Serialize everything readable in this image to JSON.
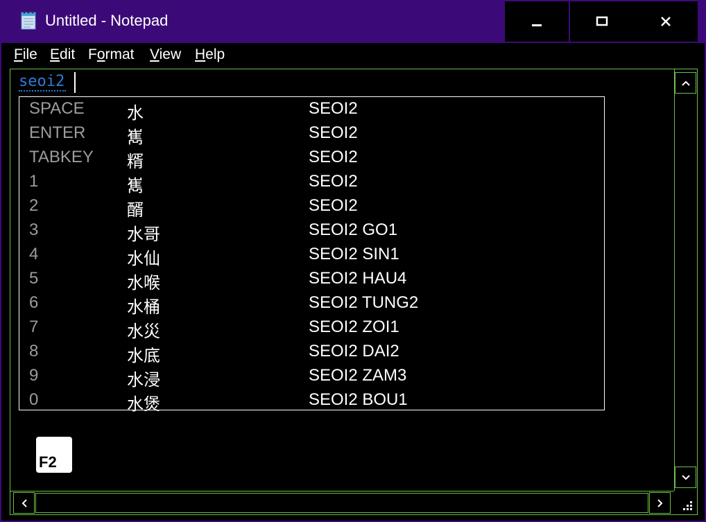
{
  "window": {
    "title": "Untitled - Notepad",
    "icons": {
      "app": "notepad-icon",
      "minimize": "minimize-icon",
      "maximize": "maximize-icon",
      "close": "close-icon"
    }
  },
  "menu": {
    "items": [
      {
        "label": "File",
        "mnemonic": "F",
        "rest": "ile"
      },
      {
        "label": "Edit",
        "mnemonic": "E",
        "rest": "dit"
      },
      {
        "label": "Format",
        "pre": "F",
        "mnemonic": "o",
        "rest": "rmat"
      },
      {
        "label": "View",
        "mnemonic": "V",
        "rest": "iew"
      },
      {
        "label": "Help",
        "mnemonic": "H",
        "rest": "elp"
      }
    ]
  },
  "editor": {
    "composition_text": "seoi2"
  },
  "candidates": [
    {
      "key": "SPACE",
      "char": "水",
      "code": "SEOI2"
    },
    {
      "key": "ENTER",
      "char": "嶲",
      "code": "SEOI2"
    },
    {
      "key": "TABKEY",
      "char": "糈",
      "code": "SEOI2"
    },
    {
      "key": "1",
      "char": "嶲",
      "code": "SEOI2"
    },
    {
      "key": "2",
      "char": "醑",
      "code": "SEOI2"
    },
    {
      "key": "3",
      "char": "水哥",
      "code": "SEOI2 GO1"
    },
    {
      "key": "4",
      "char": "水仙",
      "code": "SEOI2 SIN1"
    },
    {
      "key": "5",
      "char": "水喉",
      "code": "SEOI2 HAU4"
    },
    {
      "key": "6",
      "char": "水桶",
      "code": "SEOI2 TUNG2"
    },
    {
      "key": "7",
      "char": "水災",
      "code": "SEOI2 ZOI1"
    },
    {
      "key": "8",
      "char": "水底",
      "code": "SEOI2 DAI2"
    },
    {
      "key": "9",
      "char": "水浸",
      "code": "SEOI2 ZAM3"
    },
    {
      "key": "0",
      "char": "水煲",
      "code": "SEOI2 BOU1"
    }
  ],
  "ime": {
    "badge": "F2"
  },
  "colors": {
    "titlebar": "#3c0a78",
    "border_accent": "#6cc04a",
    "composition": "#2f7bd6",
    "candidate_key": "#9c9c9c"
  }
}
